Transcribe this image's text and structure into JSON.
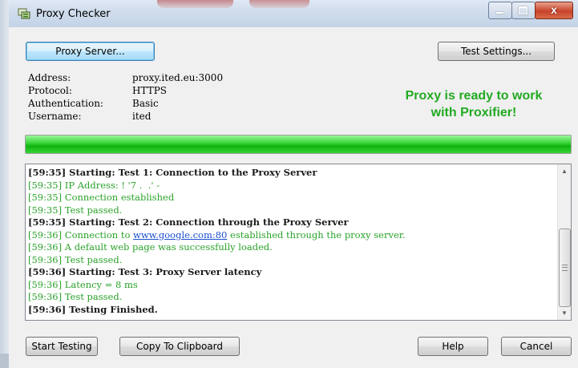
{
  "window": {
    "title": "Proxy Checker",
    "icon": "proxy-checker-app-icon",
    "caption_buttons": {
      "minimize": "minimize-icon",
      "maximize": "maximize-icon",
      "close": "x"
    }
  },
  "toolbar": {
    "proxy_server_label": "Proxy Server...",
    "test_settings_label": "Test Settings..."
  },
  "proxy_info": {
    "address_label": "Address:",
    "address_value": "proxy.ited.eu:3000",
    "protocol_label": "Protocol:",
    "protocol_value": "HTTPS",
    "auth_label": "Authentication:",
    "auth_value": "Basic",
    "username_label": "Username:",
    "username_value": "ited"
  },
  "status": {
    "line1": "Proxy is ready to work",
    "line2": "with Proxifier!",
    "color": "#22aa22"
  },
  "progress": {
    "percent": 100,
    "color": "#0eb40e"
  },
  "log": [
    {
      "text": "[59:35] Starting: Test 1: Connection to the Proxy Server",
      "style": "black"
    },
    {
      "text": "[59:35] IP Address: ! '7 .  .' -",
      "style": "green"
    },
    {
      "text": "[59:35] Connection established",
      "style": "green"
    },
    {
      "text": "[59:35] Test passed.",
      "style": "green"
    },
    {
      "text": "[59:35] Starting: Test 2: Connection through the Proxy Server",
      "style": "black"
    },
    {
      "pre": "[59:36] Connection to ",
      "link": "www.google.com:80",
      "post": " established through the proxy server.",
      "style": "green"
    },
    {
      "text": "[59:36] A default web page was successfully loaded.",
      "style": "green"
    },
    {
      "text": "[59:36] Test passed.",
      "style": "green"
    },
    {
      "text": "[59:36] Starting: Test 3: Proxy Server latency",
      "style": "black"
    },
    {
      "text": "[59:36] Latency = 8 ms",
      "style": "green"
    },
    {
      "text": "[59:36] Test passed.",
      "style": "green"
    },
    {
      "text": "[59:36] Testing Finished.",
      "style": "black"
    }
  ],
  "footer": {
    "start_testing_label": "Start Testing",
    "copy_clipboard_label": "Copy To Clipboard",
    "help_label": "Help",
    "cancel_label": "Cancel"
  }
}
